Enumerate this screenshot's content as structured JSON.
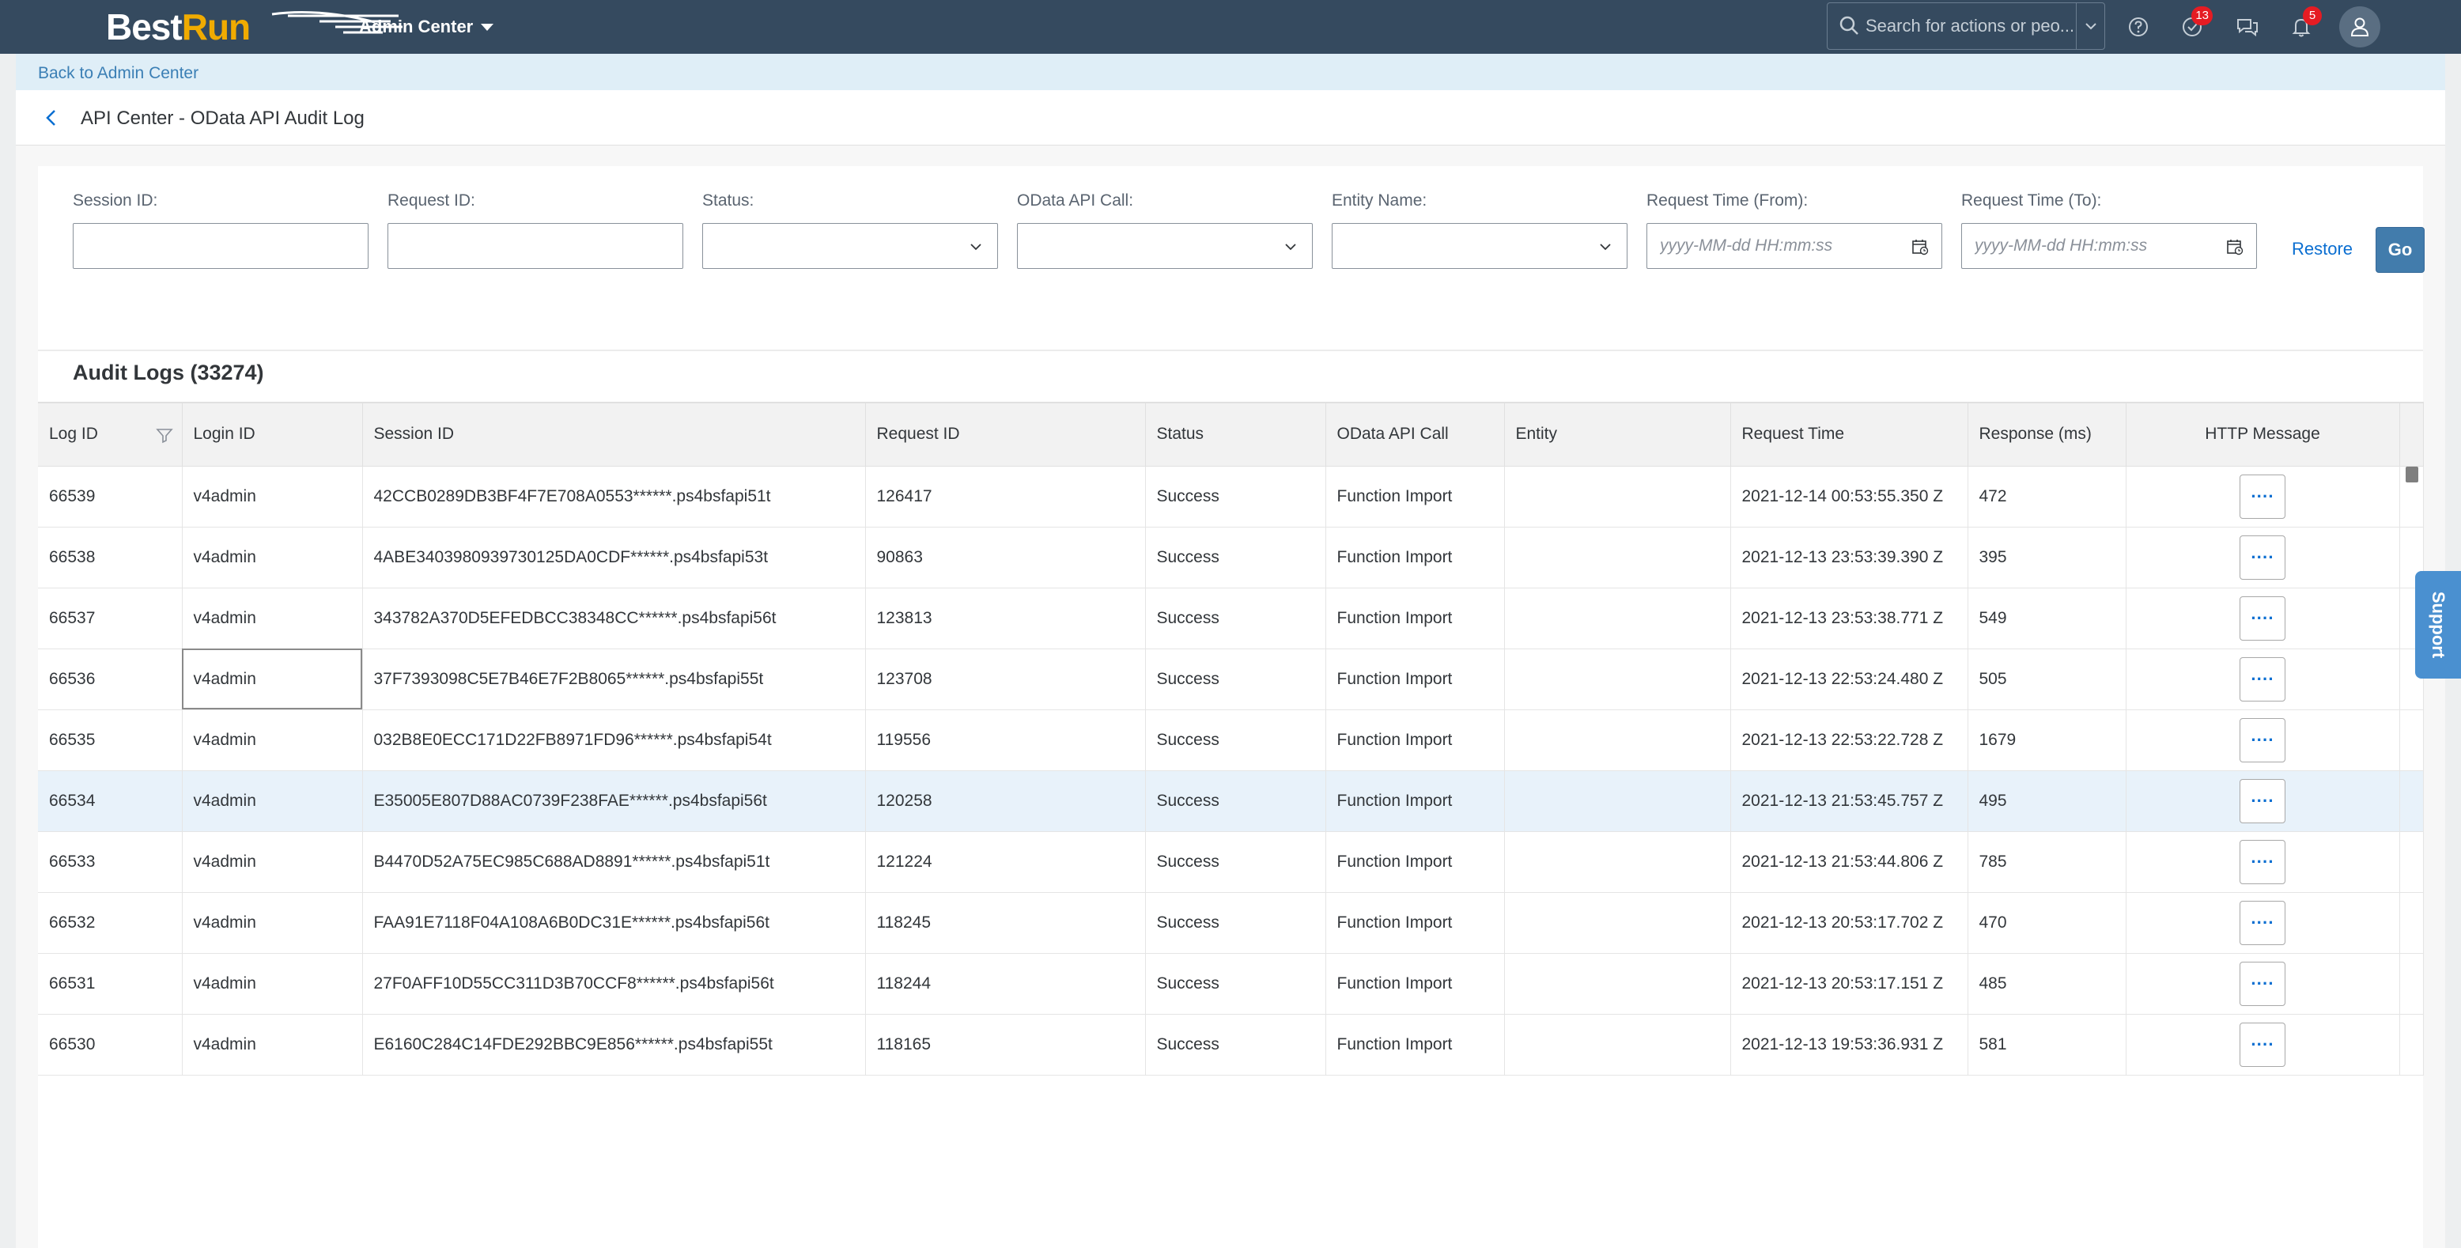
{
  "shell": {
    "logo_best": "Best",
    "logo_run": "Run",
    "app_title": "Admin Center",
    "search_placeholder": "Search for actions or peo...",
    "notifications_count": "13",
    "alerts_count": "5",
    "icons": [
      "search-icon",
      "help-icon",
      "notifications-icon",
      "feedback-icon",
      "bell-icon",
      "user-avatar-icon"
    ]
  },
  "nav": {
    "back_link": "Back to Admin Center",
    "page_title": "API Center - OData API Audit Log"
  },
  "filters": {
    "session_id_label": "Session ID:",
    "request_id_label": "Request ID:",
    "status_label": "Status:",
    "odata_call_label": "OData API Call:",
    "entity_label": "Entity Name:",
    "time_from_label": "Request Time (From):",
    "time_to_label": "Request Time (To):",
    "datetime_placeholder": "yyyy-MM-dd HH:mm:ss",
    "restore_label": "Restore",
    "go_label": "Go"
  },
  "table": {
    "title": "Audit Logs (33274)",
    "columns": [
      "Log ID",
      "Login ID",
      "Session ID",
      "Request ID",
      "Status",
      "OData API Call",
      "Entity",
      "Request Time",
      "Response (ms)",
      "HTTP Message"
    ],
    "message_button_label": "····",
    "rows": [
      {
        "log_id": "66539",
        "login": "v4admin",
        "session": "42CCB0289DB3BF4F7E708A0553******.ps4bsfapi51t",
        "request": "126417",
        "status": "Success",
        "call": "Function Import",
        "entity": "",
        "time": "2021-12-14 00:53:55.350 Z",
        "response": "472"
      },
      {
        "log_id": "66538",
        "login": "v4admin",
        "session": "4ABE3403980939730125DA0CDF******.ps4bsfapi53t",
        "request": "90863",
        "status": "Success",
        "call": "Function Import",
        "entity": "",
        "time": "2021-12-13 23:53:39.390 Z",
        "response": "395"
      },
      {
        "log_id": "66537",
        "login": "v4admin",
        "session": "343782A370D5EFEDBCC38348CC******.ps4bsfapi56t",
        "request": "123813",
        "status": "Success",
        "call": "Function Import",
        "entity": "",
        "time": "2021-12-13 23:53:38.771 Z",
        "response": "549"
      },
      {
        "log_id": "66536",
        "login": "v4admin",
        "session": "37F7393098C5E7B46E7F2B8065******.ps4bsfapi55t",
        "request": "123708",
        "status": "Success",
        "call": "Function Import",
        "entity": "",
        "time": "2021-12-13 22:53:24.480 Z",
        "response": "505"
      },
      {
        "log_id": "66535",
        "login": "v4admin",
        "session": "032B8E0ECC171D22FB8971FD96******.ps4bsfapi54t",
        "request": "119556",
        "status": "Success",
        "call": "Function Import",
        "entity": "",
        "time": "2021-12-13 22:53:22.728 Z",
        "response": "1679"
      },
      {
        "log_id": "66534",
        "login": "v4admin",
        "session": "E35005E807D88AC0739F238FAE******.ps4bsfapi56t",
        "request": "120258",
        "status": "Success",
        "call": "Function Import",
        "entity": "",
        "time": "2021-12-13 21:53:45.757 Z",
        "response": "495"
      },
      {
        "log_id": "66533",
        "login": "v4admin",
        "session": "B4470D52A75EC985C688AD8891******.ps4bsfapi51t",
        "request": "121224",
        "status": "Success",
        "call": "Function Import",
        "entity": "",
        "time": "2021-12-13 21:53:44.806 Z",
        "response": "785"
      },
      {
        "log_id": "66532",
        "login": "v4admin",
        "session": "FAA91E7118F04A108A6B0DC31E******.ps4bsfapi56t",
        "request": "118245",
        "status": "Success",
        "call": "Function Import",
        "entity": "",
        "time": "2021-12-13 20:53:17.702 Z",
        "response": "470"
      },
      {
        "log_id": "66531",
        "login": "v4admin",
        "session": "27F0AFF10D55CC311D3B70CCF8******.ps4bsfapi56t",
        "request": "118244",
        "status": "Success",
        "call": "Function Import",
        "entity": "",
        "time": "2021-12-13 20:53:17.151 Z",
        "response": "485"
      },
      {
        "log_id": "66530",
        "login": "v4admin",
        "session": "E6160C284C14FDE292BBC9E856******.ps4bsfapi55t",
        "request": "118165",
        "status": "Success",
        "call": "Function Import",
        "entity": "",
        "time": "2021-12-13 19:53:36.931 Z",
        "response": "581"
      }
    ]
  },
  "support": {
    "label": "Support"
  },
  "colors": {
    "shell_bg": "#354a5f",
    "accent": "#0a6ed1",
    "go_button": "#427cac",
    "selected_row": "#e8f2fa"
  }
}
